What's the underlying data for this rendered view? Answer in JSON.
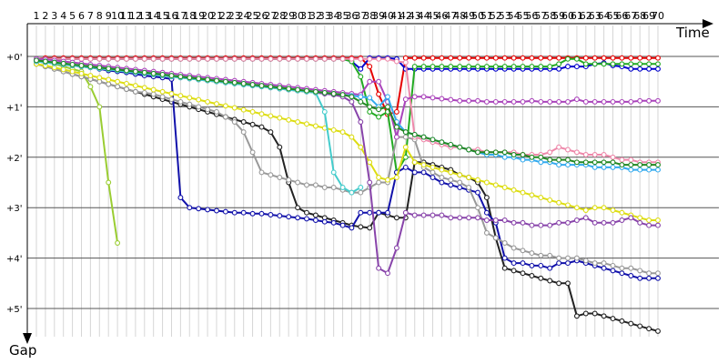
{
  "chart_data": {
    "type": "line",
    "title": "",
    "xlabel": "Time",
    "ylabel": "Gap",
    "x_ticks": [
      "1",
      "2",
      "3",
      "4",
      "5",
      "6",
      "7",
      "8",
      "9",
      "10",
      "11",
      "12",
      "13",
      "14",
      "15",
      "16",
      "17",
      "18",
      "19",
      "20",
      "21",
      "22",
      "23",
      "24",
      "25",
      "26",
      "27",
      "28",
      "29",
      "30",
      "31",
      "32",
      "33",
      "34",
      "35",
      "36",
      "37",
      "38",
      "39",
      "40",
      "41",
      "42",
      "43",
      "44",
      "45",
      "46",
      "47",
      "48",
      "49",
      "50",
      "51",
      "52",
      "53",
      "54",
      "55",
      "56",
      "57",
      "58",
      "59",
      "60",
      "61",
      "62",
      "63",
      "64",
      "65",
      "66",
      "67",
      "68",
      "69",
      "70"
    ],
    "y_ticks": [
      "+0'",
      "+1'",
      "+2'",
      "+3'",
      "+4'",
      "+5'"
    ],
    "xlim": [
      1,
      70
    ],
    "ylim": [
      0,
      5.5
    ],
    "grid": true,
    "series": [
      {
        "color": "#e60000",
        "values": [
          0.05,
          0.03,
          0.03,
          0.03,
          0.03,
          0.03,
          0.03,
          0.03,
          0.03,
          0.03,
          0.03,
          0.03,
          0.03,
          0.03,
          0.03,
          0.03,
          0.03,
          0.03,
          0.03,
          0.03,
          0.03,
          0.03,
          0.03,
          0.03,
          0.03,
          0.03,
          0.03,
          0.03,
          0.03,
          0.03,
          0.03,
          0.03,
          0.03,
          0.03,
          0.03,
          0.03,
          0.03,
          0.2,
          0.75,
          1.15,
          1.1,
          0.03,
          0.03,
          0.03,
          0.03,
          0.03,
          0.03,
          0.03,
          0.03,
          0.03,
          0.03,
          0.03,
          0.03,
          0.03,
          0.03,
          0.03,
          0.03,
          0.03,
          0.03,
          0.03,
          0.03,
          0.03,
          0.03,
          0.03,
          0.03,
          0.03,
          0.03,
          0.03,
          0.03,
          0.03
        ]
      },
      {
        "color": "#0000cc",
        "values": [
          0.05,
          0.05,
          0.05,
          0.05,
          0.05,
          0.05,
          0.05,
          0.05,
          0.05,
          0.05,
          0.05,
          0.05,
          0.05,
          0.05,
          0.05,
          0.05,
          0.05,
          0.05,
          0.05,
          0.05,
          0.05,
          0.05,
          0.05,
          0.05,
          0.05,
          0.05,
          0.05,
          0.05,
          0.05,
          0.05,
          0.05,
          0.05,
          0.05,
          0.05,
          0.05,
          0.1,
          0.25,
          0.03,
          0.03,
          0.03,
          0.05,
          0.25,
          0.25,
          0.25,
          0.25,
          0.25,
          0.25,
          0.25,
          0.25,
          0.25,
          0.25,
          0.25,
          0.25,
          0.25,
          0.25,
          0.25,
          0.25,
          0.25,
          0.25,
          0.2,
          0.2,
          0.2,
          0.15,
          0.13,
          0.18,
          0.2,
          0.25,
          0.25,
          0.25,
          0.25
        ]
      },
      {
        "color": "#22aa22",
        "values": [
          0.05,
          0.05,
          0.05,
          0.05,
          0.05,
          0.05,
          0.05,
          0.05,
          0.05,
          0.05,
          0.05,
          0.05,
          0.05,
          0.05,
          0.05,
          0.05,
          0.05,
          0.05,
          0.05,
          0.05,
          0.05,
          0.05,
          0.05,
          0.05,
          0.05,
          0.05,
          0.05,
          0.05,
          0.05,
          0.05,
          0.05,
          0.05,
          0.05,
          0.05,
          0.05,
          0.1,
          0.4,
          1.1,
          1.2,
          1.1,
          2.3,
          2.0,
          0.2,
          0.2,
          0.2,
          0.2,
          0.2,
          0.2,
          0.2,
          0.2,
          0.2,
          0.2,
          0.2,
          0.2,
          0.2,
          0.2,
          0.2,
          0.2,
          0.15,
          0.05,
          0.05,
          0.15,
          0.15,
          0.15,
          0.15,
          0.15,
          0.15,
          0.15,
          0.15,
          0.15
        ]
      },
      {
        "color": "#9acd32",
        "values": [
          0.1,
          0.1,
          0.15,
          0.2,
          0.25,
          0.3,
          0.6,
          1.0,
          2.5,
          3.7
        ]
      },
      {
        "color": "#222222",
        "values": [
          0.15,
          0.2,
          0.25,
          0.3,
          0.35,
          0.4,
          0.45,
          0.5,
          0.55,
          0.6,
          0.65,
          0.7,
          0.75,
          0.8,
          0.85,
          0.9,
          0.95,
          1.0,
          1.05,
          1.1,
          1.15,
          1.2,
          1.25,
          1.3,
          1.35,
          1.4,
          1.5,
          1.8,
          2.5,
          3.0,
          3.1,
          3.15,
          3.2,
          3.25,
          3.3,
          3.35,
          3.38,
          3.4,
          3.1,
          3.15,
          3.2,
          3.2,
          2.1,
          2.1,
          2.15,
          2.2,
          2.25,
          2.35,
          2.4,
          2.5,
          2.8,
          3.6,
          4.2,
          4.25,
          4.3,
          4.35,
          4.4,
          4.45,
          4.5,
          4.5,
          5.15,
          5.1,
          5.1,
          5.15,
          5.2,
          5.25,
          5.3,
          5.35,
          5.4,
          5.45
        ]
      },
      {
        "color": "#1111aa",
        "values": [
          0.1,
          0.12,
          0.14,
          0.16,
          0.18,
          0.2,
          0.22,
          0.25,
          0.28,
          0.3,
          0.32,
          0.35,
          0.38,
          0.4,
          0.42,
          0.45,
          2.8,
          3.0,
          3.02,
          3.04,
          3.06,
          3.08,
          3.1,
          3.1,
          3.12,
          3.12,
          3.14,
          3.16,
          3.18,
          3.2,
          3.22,
          3.25,
          3.28,
          3.3,
          3.35,
          3.4,
          3.1,
          3.1,
          3.1,
          3.1,
          2.3,
          2.2,
          2.3,
          2.3,
          2.4,
          2.5,
          2.55,
          2.6,
          2.65,
          2.7,
          3.1,
          3.3,
          4.0,
          4.1,
          4.1,
          4.15,
          4.15,
          4.2,
          4.1,
          4.1,
          4.05,
          4.1,
          4.15,
          4.2,
          4.25,
          4.3,
          4.35,
          4.4,
          4.4,
          4.4
        ]
      },
      {
        "color": "#999999",
        "values": [
          0.15,
          0.2,
          0.25,
          0.3,
          0.35,
          0.4,
          0.45,
          0.5,
          0.55,
          0.6,
          0.65,
          0.7,
          0.72,
          0.75,
          0.8,
          0.85,
          0.9,
          0.95,
          1.0,
          1.05,
          1.1,
          1.2,
          1.3,
          1.5,
          1.9,
          2.3,
          2.35,
          2.4,
          2.45,
          2.5,
          2.55,
          2.55,
          2.6,
          2.6,
          2.65,
          2.7,
          2.7,
          2.6,
          2.5,
          2.5,
          1.6,
          1.6,
          1.65,
          2.2,
          2.3,
          2.4,
          2.45,
          2.5,
          2.6,
          3.0,
          3.5,
          3.6,
          3.7,
          3.8,
          3.85,
          3.9,
          3.95,
          3.95,
          4.0,
          4.0,
          4.0,
          4.05,
          4.1,
          4.1,
          4.15,
          4.2,
          4.2,
          4.25,
          4.3,
          4.3
        ]
      },
      {
        "color": "#dddd11",
        "values": [
          0.15,
          0.18,
          0.22,
          0.26,
          0.3,
          0.34,
          0.38,
          0.42,
          0.46,
          0.5,
          0.54,
          0.58,
          0.62,
          0.66,
          0.7,
          0.74,
          0.78,
          0.82,
          0.86,
          0.9,
          0.94,
          0.98,
          1.02,
          1.06,
          1.1,
          1.14,
          1.18,
          1.22,
          1.26,
          1.3,
          1.34,
          1.38,
          1.42,
          1.46,
          1.5,
          1.6,
          1.8,
          2.1,
          2.4,
          2.45,
          2.4,
          1.8,
          2.1,
          2.15,
          2.2,
          2.25,
          2.3,
          2.35,
          2.4,
          2.45,
          2.5,
          2.55,
          2.6,
          2.65,
          2.7,
          2.75,
          2.8,
          2.85,
          2.9,
          2.95,
          3.0,
          3.05,
          3.0,
          3.0,
          3.05,
          3.1,
          3.15,
          3.2,
          3.25,
          3.25
        ]
      },
      {
        "color": "#8844aa",
        "values": [
          0.1,
          0.12,
          0.14,
          0.16,
          0.18,
          0.2,
          0.22,
          0.24,
          0.26,
          0.28,
          0.3,
          0.32,
          0.34,
          0.36,
          0.38,
          0.4,
          0.42,
          0.44,
          0.46,
          0.48,
          0.5,
          0.52,
          0.54,
          0.56,
          0.58,
          0.6,
          0.62,
          0.64,
          0.66,
          0.68,
          0.7,
          0.72,
          0.74,
          0.76,
          0.8,
          0.9,
          1.3,
          2.5,
          4.2,
          4.3,
          3.8,
          3.1,
          3.15,
          3.15,
          3.15,
          3.15,
          3.2,
          3.2,
          3.2,
          3.2,
          3.25,
          3.25,
          3.25,
          3.3,
          3.3,
          3.35,
          3.35,
          3.35,
          3.3,
          3.3,
          3.25,
          3.2,
          3.3,
          3.3,
          3.3,
          3.25,
          3.2,
          3.3,
          3.35,
          3.35
        ]
      },
      {
        "color": "#ee88aa",
        "values": [
          0.05,
          0.05,
          0.05,
          0.05,
          0.05,
          0.05,
          0.05,
          0.05,
          0.05,
          0.05,
          0.05,
          0.05,
          0.05,
          0.05,
          0.05,
          0.05,
          0.05,
          0.05,
          0.05,
          0.05,
          0.05,
          0.05,
          0.05,
          0.05,
          0.05,
          0.05,
          0.05,
          0.05,
          0.05,
          0.05,
          0.05,
          0.05,
          0.05,
          0.05,
          0.05,
          0.05,
          0.05,
          0.05,
          0.05,
          0.05,
          0.1,
          0.12,
          1.6,
          1.65,
          1.7,
          1.75,
          1.8,
          1.8,
          1.85,
          1.85,
          1.9,
          1.9,
          1.9,
          1.9,
          1.95,
          1.95,
          1.95,
          1.9,
          1.8,
          1.85,
          1.9,
          1.95,
          1.95,
          1.95,
          2.0,
          2.05,
          2.05,
          2.1,
          2.1,
          2.1
        ]
      },
      {
        "color": "#aa44bb",
        "values": [
          0.05,
          0.06,
          0.08,
          0.1,
          0.12,
          0.14,
          0.16,
          0.18,
          0.2,
          0.22,
          0.24,
          0.26,
          0.28,
          0.3,
          0.32,
          0.34,
          0.36,
          0.38,
          0.4,
          0.42,
          0.44,
          0.46,
          0.48,
          0.5,
          0.52,
          0.54,
          0.56,
          0.58,
          0.6,
          0.62,
          0.64,
          0.66,
          0.68,
          0.7,
          0.72,
          0.74,
          0.76,
          0.5,
          0.5,
          0.9,
          1.6,
          0.85,
          0.8,
          0.8,
          0.82,
          0.84,
          0.86,
          0.88,
          0.88,
          0.88,
          0.9,
          0.9,
          0.9,
          0.9,
          0.9,
          0.88,
          0.9,
          0.9,
          0.9,
          0.9,
          0.85,
          0.9,
          0.9,
          0.9,
          0.9,
          0.9,
          0.9,
          0.88,
          0.88,
          0.88
        ]
      },
      {
        "color": "#33aaee",
        "values": [
          0.08,
          0.1,
          0.12,
          0.14,
          0.16,
          0.18,
          0.2,
          0.22,
          0.24,
          0.26,
          0.28,
          0.3,
          0.32,
          0.34,
          0.36,
          0.38,
          0.4,
          0.42,
          0.44,
          0.46,
          0.48,
          0.5,
          0.52,
          0.54,
          0.56,
          0.58,
          0.6,
          0.62,
          0.64,
          0.66,
          0.68,
          0.7,
          0.72,
          0.74,
          0.76,
          0.78,
          0.8,
          0.82,
          1.0,
          0.8,
          1.3,
          1.5,
          1.55,
          1.6,
          1.65,
          1.7,
          1.75,
          1.8,
          1.85,
          1.9,
          1.95,
          1.95,
          2.0,
          2.0,
          2.05,
          2.05,
          2.1,
          2.1,
          2.15,
          2.15,
          2.15,
          2.15,
          2.2,
          2.2,
          2.2,
          2.2,
          2.25,
          2.25,
          2.25,
          2.25
        ]
      },
      {
        "color": "#44cccc",
        "values": [
          0.1,
          0.12,
          0.14,
          0.16,
          0.18,
          0.2,
          0.22,
          0.24,
          0.26,
          0.28,
          0.3,
          0.32,
          0.34,
          0.36,
          0.38,
          0.4,
          0.42,
          0.44,
          0.46,
          0.48,
          0.5,
          0.52,
          0.54,
          0.56,
          0.58,
          0.6,
          0.62,
          0.64,
          0.66,
          0.68,
          0.7,
          0.72,
          1.1,
          2.3,
          2.6,
          2.7,
          2.6
        ]
      },
      {
        "color": "#228822",
        "values": [
          0.08,
          0.1,
          0.12,
          0.14,
          0.16,
          0.18,
          0.2,
          0.22,
          0.24,
          0.26,
          0.28,
          0.3,
          0.32,
          0.34,
          0.36,
          0.38,
          0.4,
          0.42,
          0.44,
          0.46,
          0.48,
          0.5,
          0.52,
          0.54,
          0.56,
          0.58,
          0.6,
          0.62,
          0.64,
          0.66,
          0.68,
          0.7,
          0.72,
          0.74,
          0.76,
          0.8,
          0.9,
          1.0,
          1.05,
          1.0,
          1.4,
          1.5,
          1.55,
          1.6,
          1.65,
          1.7,
          1.75,
          1.8,
          1.85,
          1.9,
          1.9,
          1.9,
          1.9,
          1.95,
          1.95,
          2.0,
          2.0,
          2.05,
          2.05,
          2.05,
          2.1,
          2.1,
          2.1,
          2.1,
          2.1,
          2.15,
          2.15,
          2.15,
          2.15,
          2.15
        ]
      }
    ]
  }
}
